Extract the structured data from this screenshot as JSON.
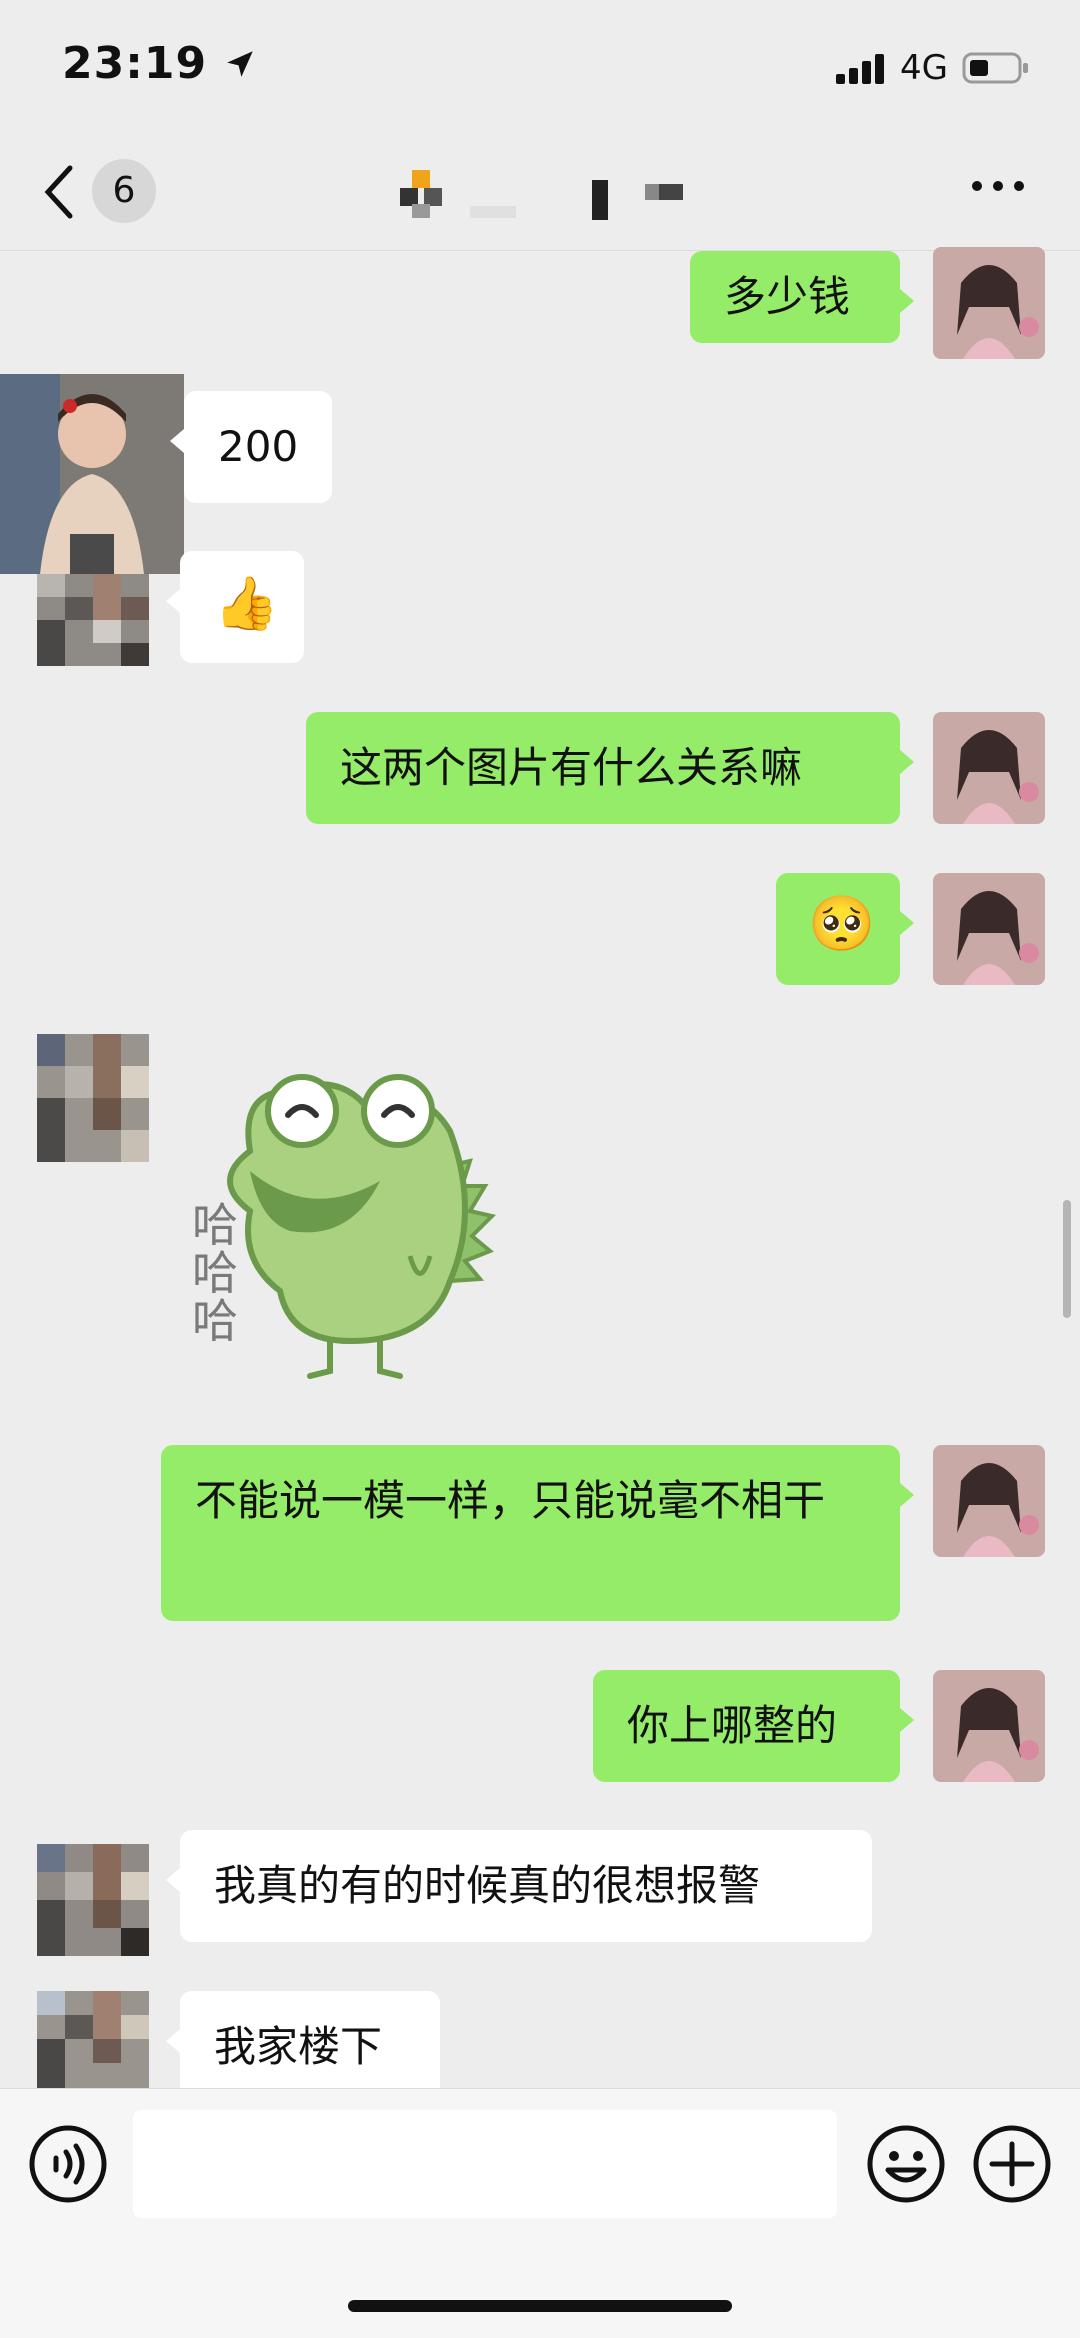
{
  "status_bar": {
    "time": "23:19",
    "network": "4G"
  },
  "nav": {
    "unread_count": "6"
  },
  "messages": [
    {
      "from": "me",
      "text": "多少钱"
    },
    {
      "from": "them",
      "text": "200"
    },
    {
      "from": "them",
      "text": "👍"
    },
    {
      "from": "me",
      "text": "这两个图片有什么关系嘛"
    },
    {
      "from": "me",
      "text": "🥺"
    },
    {
      "from": "them",
      "sticker": "frog-laughing",
      "sticker_text": "哈哈哈"
    },
    {
      "from": "me",
      "text": "不能说一模一样，只能说毫不相干"
    },
    {
      "from": "me",
      "text": "你上哪整的"
    },
    {
      "from": "them",
      "text": "我真的有的时候真的很想报警"
    },
    {
      "from": "them",
      "text": "我家楼下"
    }
  ],
  "colors": {
    "my_bubble": "#95ec69",
    "their_bubble": "#ffffff",
    "background": "#ededed"
  }
}
